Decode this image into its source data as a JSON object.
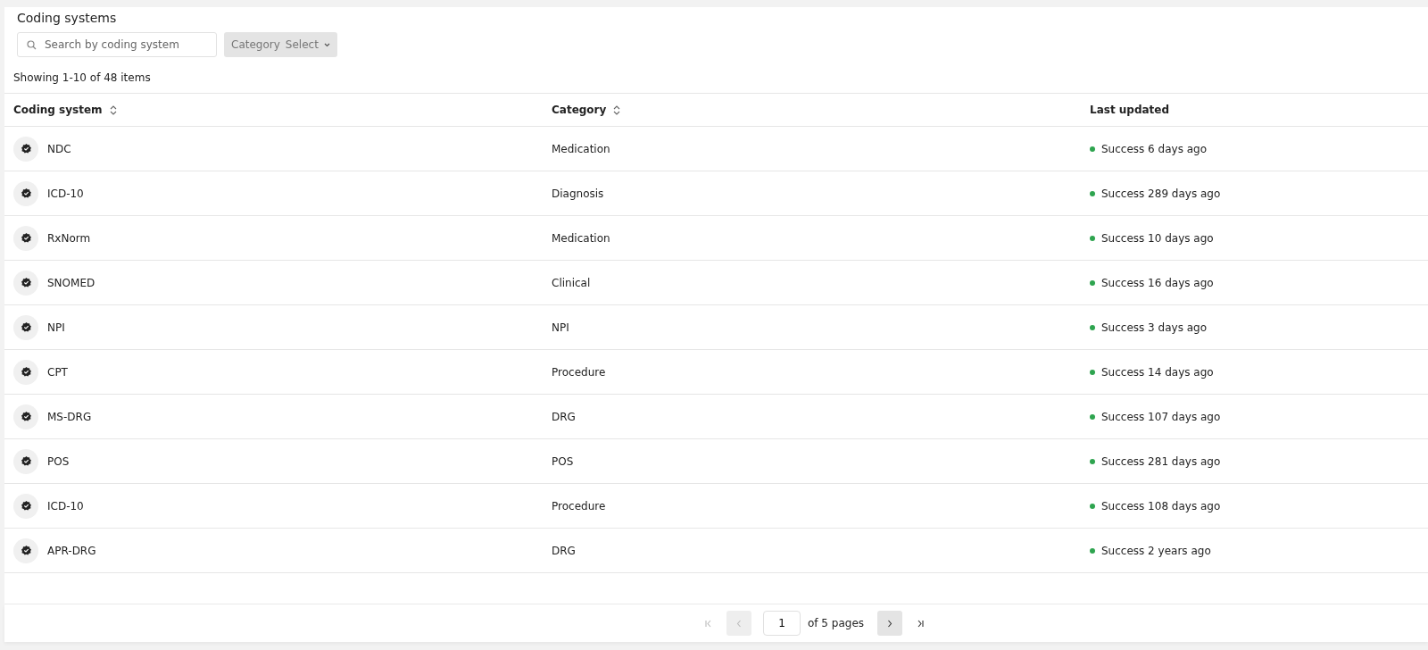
{
  "title": "Coding systems",
  "search": {
    "placeholder": "Search by coding system"
  },
  "filter": {
    "label": "Category",
    "value": "Select"
  },
  "summary": "Showing 1-10 of 48 items",
  "table": {
    "columns": [
      {
        "label": "Coding system",
        "sortable": true
      },
      {
        "label": "Category",
        "sortable": true
      },
      {
        "label": "Last updated",
        "sortable": false
      }
    ],
    "rows": [
      {
        "coding_system": "NDC",
        "category": "Medication",
        "status": "Success",
        "color": "#2ea44f",
        "updated": "6 days ago"
      },
      {
        "coding_system": "ICD-10",
        "category": "Diagnosis",
        "status": "Success",
        "color": "#2ea44f",
        "updated": "289 days ago"
      },
      {
        "coding_system": "RxNorm",
        "category": "Medication",
        "status": "Success",
        "color": "#2ea44f",
        "updated": "10 days ago"
      },
      {
        "coding_system": "SNOMED",
        "category": "Clinical",
        "status": "Success",
        "color": "#2ea44f",
        "updated": "16 days ago"
      },
      {
        "coding_system": "NPI",
        "category": "NPI",
        "status": "Success",
        "color": "#2ea44f",
        "updated": "3 days ago"
      },
      {
        "coding_system": "CPT",
        "category": "Procedure",
        "status": "Success",
        "color": "#2ea44f",
        "updated": "14 days ago"
      },
      {
        "coding_system": "MS-DRG",
        "category": "DRG",
        "status": "Success",
        "color": "#2ea44f",
        "updated": "107 days ago"
      },
      {
        "coding_system": "POS",
        "category": "POS",
        "status": "Success",
        "color": "#2ea44f",
        "updated": "281 days ago"
      },
      {
        "coding_system": "ICD-10",
        "category": "Procedure",
        "status": "Success",
        "color": "#2ea44f",
        "updated": "108 days ago"
      },
      {
        "coding_system": "APR-DRG",
        "category": "DRG",
        "status": "Success",
        "color": "#2ea44f",
        "updated": "2 years ago"
      }
    ]
  },
  "pagination": {
    "page": "1",
    "of_label": "of 5 pages",
    "first_disabled": true,
    "prev_disabled": true,
    "next_disabled": false,
    "last_disabled": false
  }
}
